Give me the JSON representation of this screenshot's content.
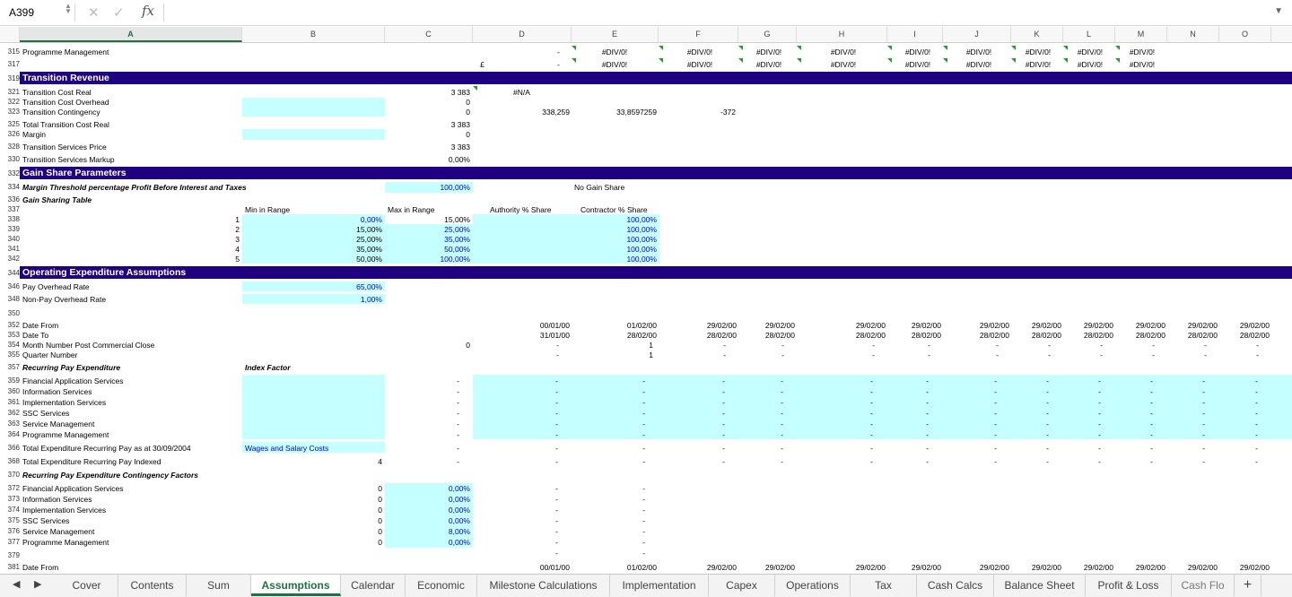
{
  "formula_bar": {
    "cell_ref": "A399",
    "cancel_icon": "✕",
    "enter_icon": "✓",
    "fx_label": "fx",
    "formula": ""
  },
  "columns": [
    "A",
    "B",
    "C",
    "D",
    "E",
    "F",
    "G",
    "H",
    "I",
    "J",
    "K",
    "L",
    "M",
    "N",
    "O"
  ],
  "rows": {
    "r315": {
      "num": "315",
      "a": "Programme Management",
      "d": "-",
      "e": "#DIV/0!",
      "f": "#DIV/0!",
      "g": "#DIV/0!",
      "h": "#DIV/0!",
      "i": "#DIV/0!",
      "j": "#DIV/0!",
      "k": "#DIV/0!",
      "l": "#DIV/0!",
      "m": "#DIV/0!"
    },
    "r317": {
      "num": "317",
      "c": "£",
      "d": "-",
      "e": "#DIV/0!",
      "f": "#DIV/0!",
      "g": "#DIV/0!",
      "h": "#DIV/0!",
      "i": "#DIV/0!",
      "j": "#DIV/0!",
      "k": "#DIV/0!",
      "l": "#DIV/0!",
      "m": "#DIV/0!"
    },
    "r319": {
      "num": "319",
      "title": "Transition Revenue"
    },
    "r321": {
      "num": "321",
      "a": "Transition Cost Real",
      "c": "3 383",
      "d": "#N/A"
    },
    "r322": {
      "num": "322",
      "a": "Transition Cost Overhead",
      "c": "0"
    },
    "r323": {
      "num": "323",
      "a": "Transition Contingency",
      "c": "0",
      "d": "338,259",
      "e": "33,8597259",
      "f": "-372"
    },
    "r325": {
      "num": "325",
      "a": "Total Transition Cost Real",
      "c": "3 383"
    },
    "r326": {
      "num": "326",
      "a": "Margin",
      "c": "0"
    },
    "r328": {
      "num": "328",
      "a": "Transition Services Price",
      "c": "3 383"
    },
    "r330": {
      "num": "330",
      "a": "Transition Services Markup",
      "c": "0,00%"
    },
    "r332": {
      "num": "332",
      "title": "Gain Share Parameters"
    },
    "r334": {
      "num": "334",
      "a": "Margin Threshold percentage Profit Before Interest and Taxes",
      "c": "100,00%",
      "e": "No Gain Share"
    },
    "r336": {
      "num": "336",
      "a": "Gain Sharing Table"
    },
    "r337": {
      "num": "337",
      "b": "Min in Range",
      "c": "Max in Range",
      "d": "Authority % Share",
      "e": "Contractor % Share"
    },
    "r338": {
      "num": "338",
      "idx": "1",
      "b": "0,00%",
      "c": "15,00%",
      "e": "100,00%"
    },
    "r339": {
      "num": "339",
      "idx": "2",
      "b": "15,00%",
      "c": "25,00%",
      "e": "100,00%"
    },
    "r340": {
      "num": "340",
      "idx": "3",
      "b": "25,00%",
      "c": "35,00%",
      "e": "100,00%"
    },
    "r341": {
      "num": "341",
      "idx": "4",
      "b": "35,00%",
      "c": "50,00%",
      "e": "100,00%"
    },
    "r342": {
      "num": "342",
      "idx": "5",
      "b": "50,00%",
      "c": "100,00%",
      "e": "100,00%"
    },
    "r344": {
      "num": "344",
      "title": "Operating Expenditure Assumptions"
    },
    "r346": {
      "num": "346",
      "a": "Pay Overhead Rate",
      "b": "65,00%"
    },
    "r348": {
      "num": "348",
      "a": "Non-Pay Overhead Rate",
      "b": "1,00%"
    },
    "r350": {
      "num": "350"
    },
    "r352": {
      "num": "352",
      "a": "Date From",
      "d": "00/01/00",
      "e": "01/02/00",
      "f": "29/02/00",
      "g": "29/02/00",
      "h": "29/02/00",
      "i": "29/02/00",
      "j": "29/02/00",
      "k": "29/02/00",
      "l": "29/02/00",
      "m": "29/02/00",
      "n": "29/02/00",
      "o": "29/02/00"
    },
    "r353": {
      "num": "353",
      "a": "Date To",
      "d": "31/01/00",
      "e": "28/02/00",
      "f": "28/02/00",
      "g": "28/02/00",
      "h": "28/02/00",
      "i": "28/02/00",
      "j": "28/02/00",
      "k": "28/02/00",
      "l": "28/02/00",
      "m": "28/02/00",
      "n": "28/02/00",
      "o": "28/02/00"
    },
    "r354": {
      "num": "354",
      "a": "Month Number Post Commercial Close",
      "c": "0",
      "d": "-",
      "e": "1",
      "f": "-",
      "g": "-",
      "h": "-",
      "i": "-",
      "j": "-",
      "k": "-",
      "l": "-",
      "m": "-",
      "n": "-",
      "o": "-"
    },
    "r355": {
      "num": "355",
      "a": "Quarter Number",
      "d": "-",
      "e": "1",
      "f": "-",
      "g": "-",
      "h": "-",
      "i": "-",
      "j": "-",
      "k": "-",
      "l": "-",
      "m": "-",
      "n": "-",
      "o": "-"
    },
    "r357": {
      "num": "357",
      "a": "Recurring Pay Expenditure",
      "b": "Index Factor"
    },
    "r359": {
      "num": "359",
      "a": "Financial Application Services"
    },
    "r360": {
      "num": "360",
      "a": "Information Services"
    },
    "r361": {
      "num": "361",
      "a": "Implementation Services"
    },
    "r362": {
      "num": "362",
      "a": "SSC Services"
    },
    "r363": {
      "num": "363",
      "a": "Service Management"
    },
    "r364": {
      "num": "364",
      "a": "Programme Management"
    },
    "r366": {
      "num": "366",
      "a": "Total Expenditure Recurring Pay as at 30/09/2004",
      "b": "Wages and Salary Costs"
    },
    "r368": {
      "num": "368",
      "a": "Total Expenditure Recurring Pay Indexed",
      "b": "4"
    },
    "r370": {
      "num": "370",
      "a": "Recurring Pay Expenditure Contingency Factors"
    },
    "r372": {
      "num": "372",
      "a": "Financial Application Services",
      "b": "0",
      "c": "0,00%"
    },
    "r373": {
      "num": "373",
      "a": "Information Services",
      "b": "0",
      "c": "0,00%"
    },
    "r374": {
      "num": "374",
      "a": "Implementation Services",
      "b": "0",
      "c": "0,00%"
    },
    "r375": {
      "num": "375",
      "a": "SSC Services",
      "b": "0",
      "c": "0,00%"
    },
    "r376": {
      "num": "376",
      "a": "Service Management",
      "b": "0",
      "c": "8,00%"
    },
    "r377": {
      "num": "377",
      "a": "Programme Management",
      "b": "0",
      "c": "0,00%"
    },
    "r379": {
      "num": "379"
    },
    "r381": {
      "num": "381",
      "a": "Date From",
      "d": "00/01/00",
      "e": "01/02/00",
      "f": "29/02/00",
      "g": "29/02/00",
      "h": "29/02/00",
      "i": "29/02/00",
      "j": "29/02/00",
      "k": "29/02/00",
      "l": "29/02/00",
      "m": "29/02/00",
      "n": "29/02/00",
      "o": "29/02/00"
    }
  },
  "dash": "-",
  "tabs": [
    "Cover",
    "Contents",
    "Sum",
    "Assumptions",
    "Calendar",
    "Economic",
    "Milestone Calculations",
    "Implementation",
    "Capex",
    "Operations",
    "Tax",
    "Cash Calcs",
    "Balance Sheet",
    "Profit & Loss",
    "Cash Flo"
  ],
  "active_tab": "Assumptions",
  "add_sheet": "+",
  "nav_prev": "◀",
  "nav_next": "▶"
}
